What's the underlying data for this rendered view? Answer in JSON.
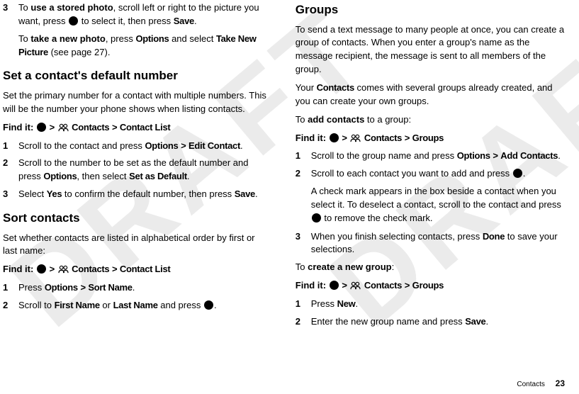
{
  "watermark": "DRAFT",
  "left": {
    "item3": {
      "num": "3",
      "text_pre": "To ",
      "bold1": "use a stored photo",
      "text_mid1": ", scroll left or right to the picture you want, press ",
      "text_mid2": " to select it, then press ",
      "save": "Save",
      "period": "."
    },
    "item3b": {
      "pre": "To ",
      "bold": "take a new photo",
      "mid": ", press ",
      "options": "Options",
      "mid2": " and select ",
      "take": "Take New Picture",
      "end": " (see page 27)."
    },
    "h_default": "Set a contact's default number",
    "default_intro": "Set the primary number for a contact with multiple numbers. This will be the number your phone shows when listing contacts.",
    "findit1": {
      "label": "Find it:",
      "gt1": ">",
      "contacts": "Contacts",
      "gt2": ">",
      "list": "Contact List"
    },
    "d1": {
      "num": "1",
      "pre": "Scroll to the contact and press ",
      "options": "Options",
      "gt": ">",
      "edit": "Edit Contact",
      "end": "."
    },
    "d2": {
      "num": "2",
      "pre": "Scroll to the number to be set as the default number and press ",
      "options": "Options",
      "mid": ", then select ",
      "set": "Set as Default",
      "end": "."
    },
    "d3": {
      "num": "3",
      "pre": "Select ",
      "yes": "Yes",
      "mid": " to confirm the default number, then press ",
      "save": "Save",
      "end": "."
    },
    "h_sort": "Sort contacts",
    "sort_intro": "Set whether contacts are listed in alphabetical order by first or last name:",
    "findit2": {
      "label": "Find it:",
      "gt1": ">",
      "contacts": "Contacts",
      "gt2": ">",
      "list": "Contact List"
    },
    "s1": {
      "num": "1",
      "pre": "Press ",
      "options": "Options",
      "gt": ">",
      "sort": "Sort Name",
      "end": "."
    },
    "s2": {
      "num": "2",
      "pre": "Scroll to ",
      "first": "First Name",
      "or": " or ",
      "last": "Last Name",
      "mid": " and press ",
      "end": "."
    }
  },
  "right": {
    "h_groups": "Groups",
    "groups_intro": "To send a text message to many people at once, you can create a group of contacts. When you enter a group's name as the message recipient, the message is sent to all members of the group.",
    "groups_p2_pre": "Your ",
    "groups_p2_contacts": "Contacts",
    "groups_p2_post": " comes with several groups already created, and you can create your own groups.",
    "addc_pre": "To ",
    "addc_bold": "add contacts",
    "addc_post": " to a group:",
    "findit3": {
      "label": "Find it:",
      "gt1": ">",
      "contacts": "Contacts",
      "gt2": ">",
      "groups": "Groups"
    },
    "g1": {
      "num": "1",
      "pre": "Scroll to the group name and press ",
      "options": "Options",
      "gt": ">",
      "add": "Add Contacts",
      "end": "."
    },
    "g2": {
      "num": "2",
      "pre": "Scroll to each contact you want to add and press ",
      "end": "."
    },
    "g2b": {
      "pre": "A check mark appears in the box beside a contact when you select it. To deselect a contact, scroll to the contact and press ",
      "post": " to remove the check mark."
    },
    "g3": {
      "num": "3",
      "pre": "When you finish selecting contacts, press ",
      "done": "Done",
      "post": " to save your selections."
    },
    "newg_pre": "To ",
    "newg_bold": "create a new group",
    "newg_post": ":",
    "findit4": {
      "label": "Find it:",
      "gt1": ">",
      "contacts": "Contacts",
      "gt2": ">",
      "groups": "Groups"
    },
    "n1": {
      "num": "1",
      "pre": "Press ",
      "new": "New",
      "end": "."
    },
    "n2": {
      "num": "2",
      "pre": "Enter the new group name and press ",
      "save": "Save",
      "end": "."
    }
  },
  "footer": {
    "label": "Contacts",
    "page": "23"
  }
}
